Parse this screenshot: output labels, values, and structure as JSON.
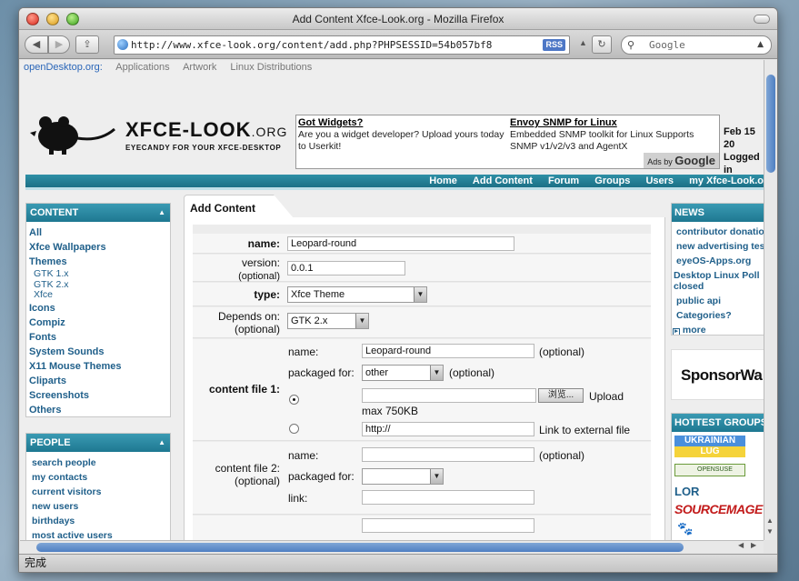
{
  "window": {
    "title": "Add Content Xfce-Look.org - Mozilla Firefox"
  },
  "toolbar": {
    "url": "http://www.xfce-look.org/content/add.php?PHPSESSID=54b057bf8",
    "rss_label": "RSS",
    "search_placeholder": "Google"
  },
  "status_text": "完成",
  "od_bar": {
    "brand": "openDesktop.org:",
    "links": [
      "Applications",
      "Artwork",
      "Linux Distributions"
    ]
  },
  "logo": {
    "main": "XFCE-LOOK",
    "org": ".ORG",
    "tagline": "EYECANDY FOR YOUR XFCE-DESKTOP"
  },
  "ads": [
    {
      "title": "Got Widgets?",
      "text": "Are you a widget developer? Upload yours today to Userkit!"
    },
    {
      "title": "Envoy SNMP for Linux",
      "text": "Embedded SNMP toolkit for Linux Supports SNMP v1/v2/v3 and AgentX"
    }
  ],
  "ads_by": "Ads by",
  "ads_brand": "Google",
  "date_info": {
    "date": "Feb 15 20",
    "login": "Logged in"
  },
  "nav": [
    "Home",
    "Add Content",
    "Forum",
    "Groups",
    "Users",
    "my Xfce-Look.o"
  ],
  "content_box": {
    "title": "CONTENT",
    "items": [
      "All",
      "Xfce Wallpapers",
      "Themes"
    ],
    "sub_items": [
      "GTK 1.x",
      "GTK 2.x",
      "Xfce"
    ],
    "items2": [
      "Icons",
      "Compiz",
      "Fonts",
      "System Sounds",
      "X11 Mouse Themes",
      "Cliparts",
      "Screenshots",
      "Others"
    ]
  },
  "people_box": {
    "title": "PEOPLE",
    "items": [
      "search people",
      "my contacts",
      "current visitors",
      "new users",
      "birthdays",
      "most active users"
    ]
  },
  "news_box": {
    "title": "NEWS",
    "items": [
      "contributor donation",
      "new advertising tes",
      "eyeOS-Apps.org",
      "Desktop Linux Poll closed",
      "public api",
      "Categories?"
    ],
    "more": "more"
  },
  "sponsor_text": "SponsorWa",
  "hottest": {
    "title": "HOTTEST GROUPS",
    "ukr_top": "UKRAINIAN",
    "ukr_bottom": "LUG",
    "opensuse": "OPENSUSE",
    "lor": "LOR",
    "sourcemage": "SOURCEMAGE"
  },
  "form": {
    "tab_title": "Add Content",
    "name_label": "name:",
    "name_value": "Leopard-round",
    "version_label": "version:",
    "version_opt": "(optional)",
    "version_value": "0.0.1",
    "type_label": "type:",
    "type_value": "Xfce Theme",
    "depends_label": "Depends on:",
    "depends_opt": "(optional)",
    "depends_value": "GTK 2.x",
    "file1_label": "content file 1:",
    "file1_name_label": "name:",
    "file1_name_value": "Leopard-round",
    "optional": "(optional)",
    "packaged_label": "packaged for:",
    "packaged_value": "other",
    "browse_label": "浏览...",
    "upload_label": "Upload",
    "max_size": "max 750KB",
    "link_value": "http://",
    "external_label": "Link to external file",
    "file2_label": "content file 2:",
    "file2_opt": "(optional)",
    "file2_name_label": "name:",
    "file2_packaged_label": "packaged for:",
    "file2_link_label": "link:"
  }
}
